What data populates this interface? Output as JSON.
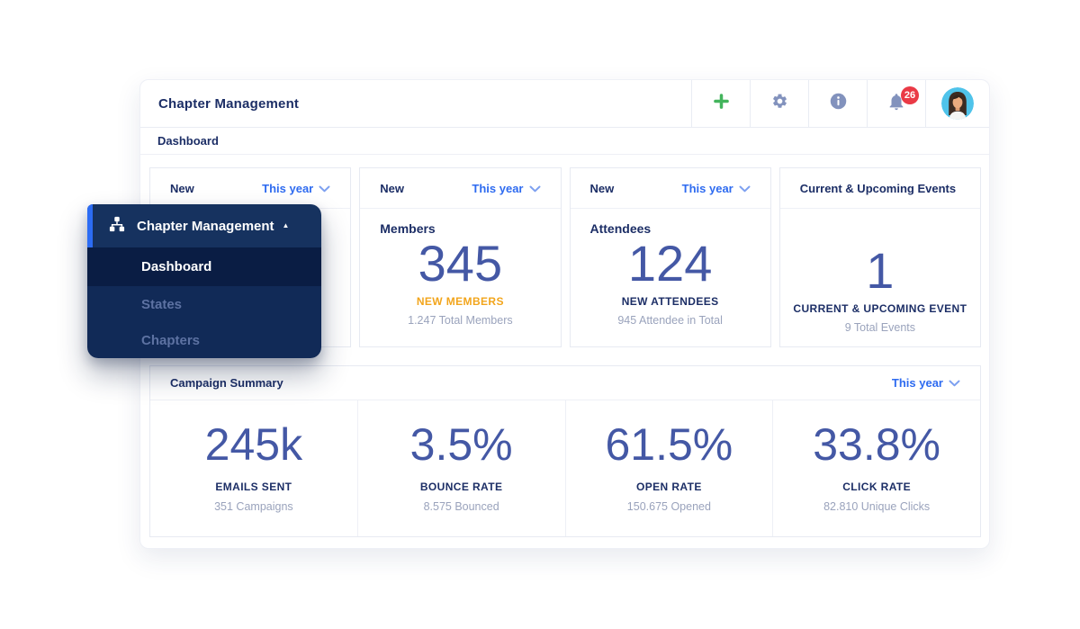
{
  "header": {
    "title": "Chapter Management",
    "notifications_badge": "26"
  },
  "breadcrumb": {
    "label": "Dashboard"
  },
  "nav_menu": {
    "title": "Chapter Management",
    "items": [
      {
        "label": "Dashboard",
        "active": true
      },
      {
        "label": "States",
        "active": false
      },
      {
        "label": "Chapters",
        "active": false
      }
    ]
  },
  "stat_cards": {
    "card1": {
      "filter": "New",
      "period": "This year"
    },
    "card2": {
      "filter": "New",
      "period": "This year",
      "title": "Members",
      "value": "345",
      "highlight": "NEW MEMBERS",
      "subtext": "1.247 Total Members"
    },
    "card3": {
      "filter": "New",
      "period": "This year",
      "title": "Attendees",
      "value": "124",
      "highlight": "NEW ATTENDEES",
      "subtext": "945 Attendee in Total"
    },
    "card4": {
      "title": "Current & Upcoming Events",
      "value": "1",
      "highlight": "CURRENT & UPCOMING EVENT",
      "subtext": "9 Total Events"
    }
  },
  "campaign_summary": {
    "title": "Campaign Summary",
    "period": "This year",
    "stats": [
      {
        "value": "245k",
        "label": "EMAILS SENT",
        "subtext": "351 Campaigns"
      },
      {
        "value": "3.5%",
        "label": "BOUNCE RATE",
        "subtext": "8.575 Bounced"
      },
      {
        "value": "61.5%",
        "label": "OPEN RATE",
        "subtext": "150.675 Opened"
      },
      {
        "value": "33.8%",
        "label": "CLICK RATE",
        "subtext": "82.810 Unique Clicks"
      }
    ]
  },
  "icons": {
    "add": "plus-icon",
    "settings": "gear-icon",
    "info": "info-icon",
    "notifications": "bell-icon",
    "profile": "avatar",
    "nav": "sitemap-icon",
    "period_dropdown": "chevron-down-icon",
    "nav_collapse": "caret-up-icon"
  },
  "colors": {
    "accent_blue": "#2e6bf0",
    "navy_text": "#1c2e66",
    "stat_number": "#4458a5",
    "highlight_orange": "#f2a51c",
    "muted_text": "#9aa3bc",
    "icon_slate": "#8292bd",
    "success_green": "#43b45c",
    "alert_red": "#ea3a46",
    "menu_header_bg": "#16325f",
    "menu_body_bg": "#112a57",
    "menu_active_bg": "#0a1d44",
    "menu_muted_text": "#5d72a2",
    "menu_accent": "#2c6cf4",
    "avatar_bg": "#4fc3ea"
  }
}
